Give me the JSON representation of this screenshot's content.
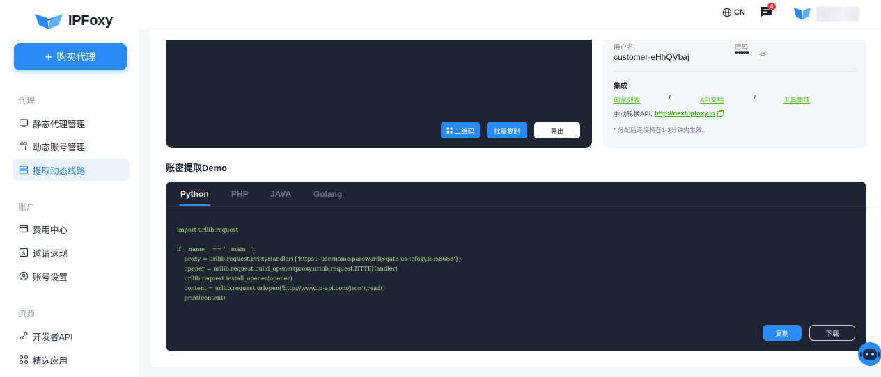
{
  "brand": {
    "name": "IPFoxy"
  },
  "sidebar": {
    "buy_button": "购买代理",
    "sections": [
      {
        "title": "代理",
        "items": [
          {
            "label": "静态代理管理",
            "icon": "monitor-icon"
          },
          {
            "label": "动态账号管理",
            "icon": "user-switch-icon"
          },
          {
            "label": "提取动态线路",
            "icon": "server-icon",
            "active": true
          }
        ]
      },
      {
        "title": "账户",
        "items": [
          {
            "label": "费用中心",
            "icon": "wallet-icon"
          },
          {
            "label": "邀请返现",
            "icon": "dollar-icon"
          },
          {
            "label": "账号设置",
            "icon": "user-circle-icon"
          }
        ]
      },
      {
        "title": "资源",
        "items": [
          {
            "label": "开发者API",
            "icon": "link-icon"
          },
          {
            "label": "精选应用",
            "icon": "apps-icon"
          }
        ]
      }
    ]
  },
  "header": {
    "language": "CN",
    "message_count": "4"
  },
  "preview": {
    "qr_button": "二维码",
    "batch_copy_button": "批量复制",
    "export_button": "导出"
  },
  "info": {
    "username_label": "用户名",
    "username": "customer-eHhQVbaj",
    "password_label": "密码",
    "password": "••••••••",
    "integration_title": "集成",
    "links": [
      "国家列表",
      "API文档",
      "工具集成"
    ],
    "separator": "/",
    "rotate_label": "手动轮换API:",
    "rotate_url": "http://next.ipfoxy.io",
    "note": "* 分配后连接将在1-3分钟内生效。"
  },
  "demo": {
    "title": "账密提取Demo",
    "tabs": [
      "Python",
      "PHP",
      "JAVA",
      "Golang"
    ],
    "active_tab": "Python",
    "code": "import urllib.request\n\nif __name__ == '__main__':\n    proxy = urllib.request.ProxyHandler({'https': 'username:password@gate-us-ipfoxy.io:58688'})\n    opener = urllib.request.build_opener(proxy,urllib.request.HTTPHandler)\n    urllib.request.install_opener(opener)\n    content = urllib.request.urlopen('http://www.ip-api.com/json').read()\n    print(content)",
    "copy_button": "复制",
    "download_button": "下载"
  },
  "colors": {
    "accent": "#2a8af6",
    "code_bg": "#1e2432",
    "link_green": "#52c21d",
    "badge_red": "#f5333f"
  }
}
